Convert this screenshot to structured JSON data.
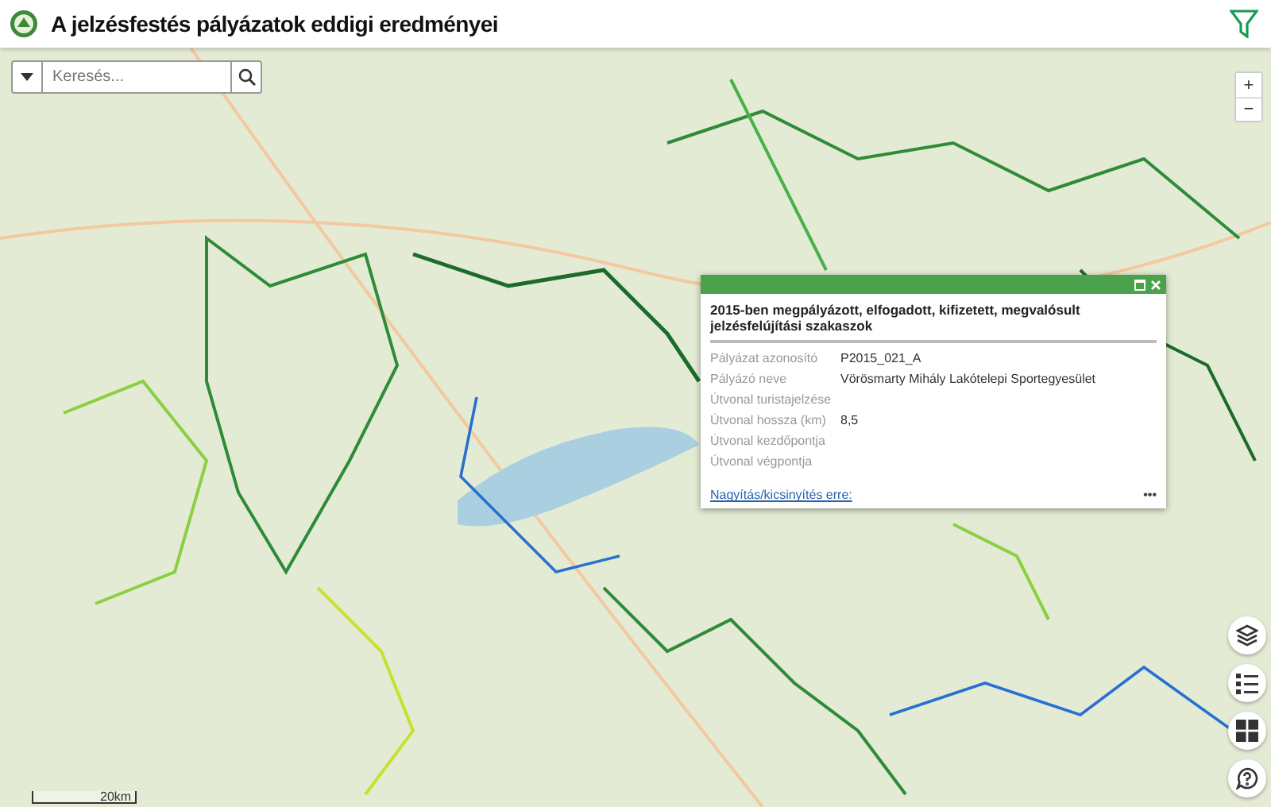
{
  "header": {
    "title": "A jelzésfestés pályázatok eddigi eredményei"
  },
  "search": {
    "placeholder": "Keresés..."
  },
  "zoom_controls": [
    "+",
    "−"
  ],
  "popup": {
    "title": "2015-ben megpályázott, elfogadott, kifizetett, megvalósult jelzésfelújítási szakaszok",
    "fields": [
      {
        "label": "Pályázat azonosító",
        "value": "P2015_021_A"
      },
      {
        "label": "Pályázó neve",
        "value": "Vörösmarty Mihály Lakótelepi Sportegyesület"
      },
      {
        "label": "Útvonal turistajelzése"
      },
      {
        "label": "Útvonal hossza (km)",
        "value": "8,5"
      },
      {
        "label": "Útvonal kezdőpontja"
      },
      {
        "label": "Útvonal végpontja"
      }
    ],
    "link": "Nagyítás/kicsinyítés erre:",
    "more": "•••"
  },
  "map_tools": [
    {
      "kind": "layers"
    },
    {
      "kind": "legend"
    },
    {
      "kind": "basemap"
    },
    {
      "kind": "help"
    }
  ],
  "scale": {
    "label": "20km"
  }
}
